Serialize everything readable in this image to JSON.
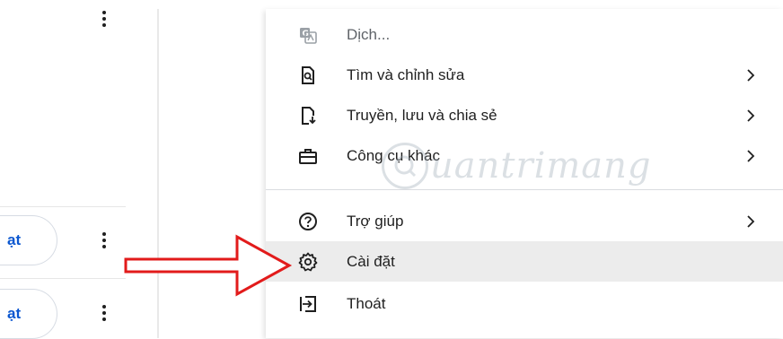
{
  "left_panel": {
    "buttons": [
      {
        "label": "ạt"
      },
      {
        "label": "ạt"
      }
    ]
  },
  "menu": {
    "items": [
      {
        "label": "Dịch...",
        "icon": "translate-icon",
        "disabled": true,
        "submenu": false
      },
      {
        "label": "Tìm và chỉnh sửa",
        "icon": "find-icon",
        "submenu": true
      },
      {
        "label": "Truyền, lưu và chia sẻ",
        "icon": "cast-save-share-icon",
        "submenu": true
      },
      {
        "label": "Công cụ khác",
        "icon": "toolbox-icon",
        "submenu": true
      },
      {
        "label": "Trợ giúp",
        "icon": "help-icon",
        "submenu": true
      },
      {
        "label": "Cài đặt",
        "icon": "settings-gear-icon",
        "submenu": false,
        "highlighted": true
      },
      {
        "label": "Thoát",
        "icon": "exit-icon",
        "submenu": false
      }
    ]
  },
  "watermark": {
    "text": "uantrimang"
  },
  "colors": {
    "accent": "#0b57d0",
    "arrow": "#e21b1b",
    "highlight": "#ececec"
  }
}
